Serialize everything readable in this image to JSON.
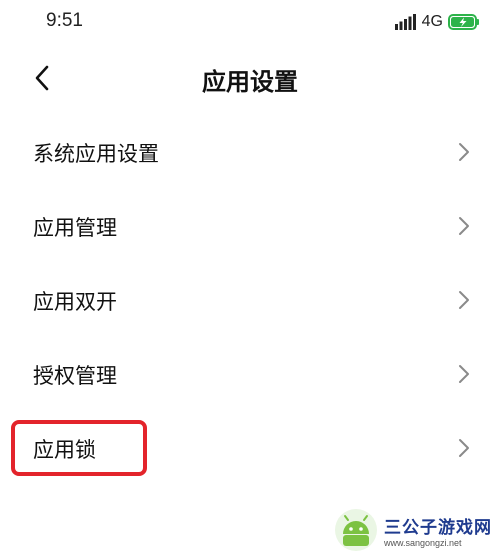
{
  "status_bar": {
    "time": "9:51",
    "network": "4G",
    "signal_icon": "signal-bars-icon",
    "battery_icon": "battery-charging-icon",
    "battery_color": "#2db34a"
  },
  "header": {
    "title": "应用设置",
    "back_icon": "chevron-left-icon"
  },
  "settings": {
    "items": [
      {
        "label": "系统应用设置"
      },
      {
        "label": "应用管理"
      },
      {
        "label": "应用双开"
      },
      {
        "label": "授权管理"
      },
      {
        "label": "应用锁"
      }
    ],
    "highlight_color": "#e3242b"
  },
  "watermark": {
    "name": "三公子游戏网",
    "url": "www.sangongzi.net"
  }
}
